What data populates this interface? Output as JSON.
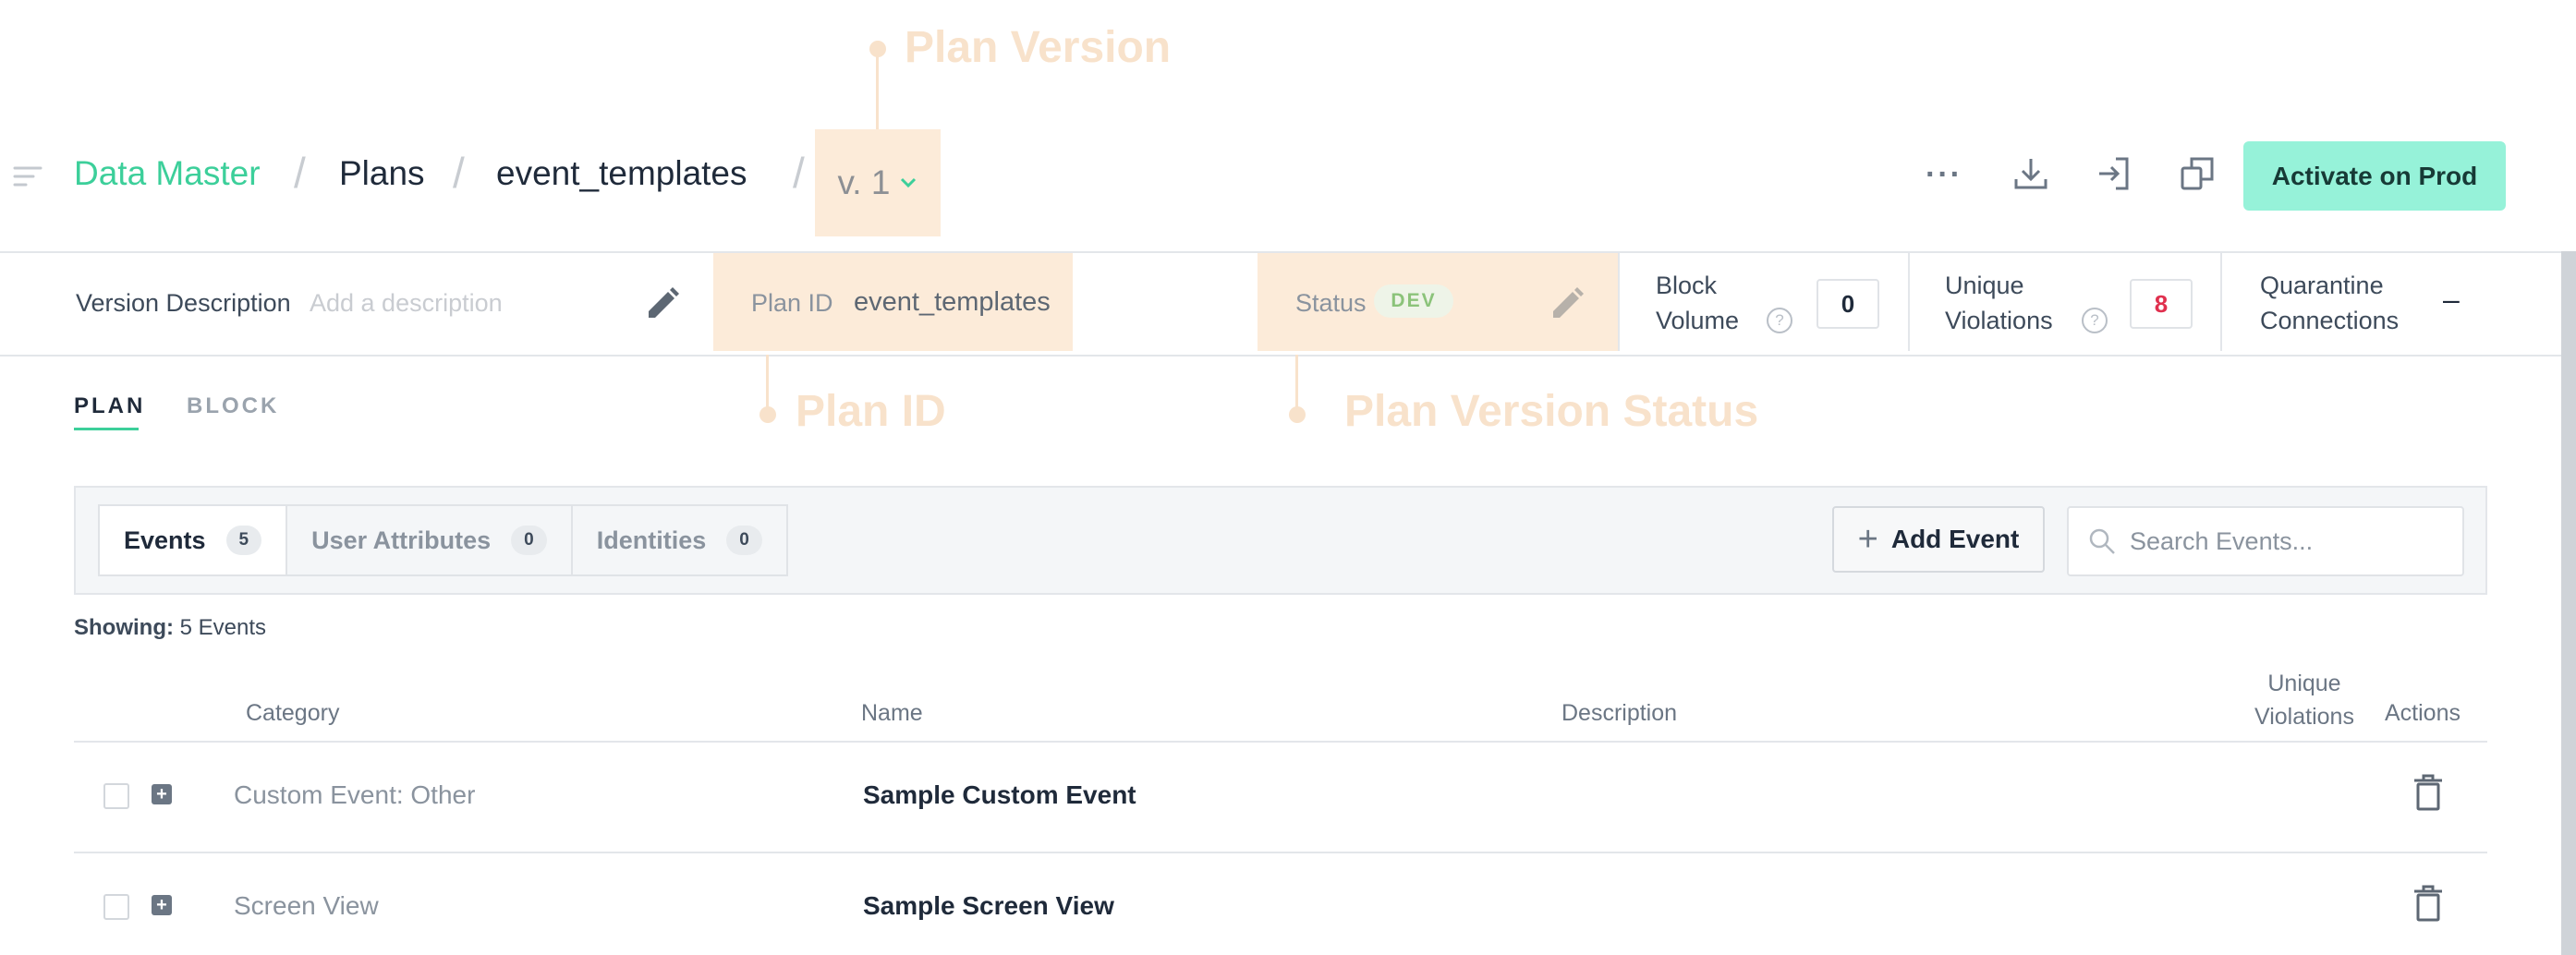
{
  "callouts": {
    "plan_version": "Plan Version",
    "plan_id": "Plan ID",
    "plan_version_status": "Plan Version Status"
  },
  "breadcrumb": {
    "brand": "Data Master",
    "sep": "/",
    "plans": "Plans",
    "plan_name": "event_templates",
    "version": "v. 1"
  },
  "header": {
    "more_label": "···",
    "activate_button": "Activate on Prod"
  },
  "info": {
    "version_description_label": "Version Description",
    "version_description_placeholder": "Add a description",
    "plan_id_label": "Plan ID",
    "plan_id_value": "event_templates",
    "status_label": "Status",
    "status_value": "DEV",
    "block_volume_line1": "Block",
    "block_volume_line2": "Volume",
    "block_volume_value": "0",
    "unique_violations_line1": "Unique",
    "unique_violations_line2": "Violations",
    "unique_violations_value": "8",
    "quarantine_line1": "Quarantine",
    "quarantine_line2": "Connections",
    "quarantine_value": "–",
    "help_glyph": "?"
  },
  "tabs": {
    "plan": "PLAN",
    "block": "BLOCK"
  },
  "subtabs": [
    {
      "label": "Events",
      "count": "5"
    },
    {
      "label": "User Attributes",
      "count": "0"
    },
    {
      "label": "Identities",
      "count": "0"
    }
  ],
  "toolbar": {
    "add_event_label": "Add Event",
    "add_glyph": "+",
    "search_placeholder": "Search Events..."
  },
  "showing": {
    "prefix": "Showing:",
    "text": "5 Events"
  },
  "table": {
    "headers": {
      "category": "Category",
      "name": "Name",
      "description": "Description",
      "unique_line1": "Unique",
      "unique_line2": "Violations",
      "actions": "Actions"
    },
    "expand_glyph": "+",
    "rows": [
      {
        "category": "Custom Event: Other",
        "name": "Sample Custom Event",
        "description": ""
      },
      {
        "category": "Screen View",
        "name": "Sample Screen View",
        "description": ""
      }
    ]
  },
  "colors": {
    "brand": "#3ccf9a",
    "annotation": "#f8e2cb",
    "highlight": "#fcebd9",
    "activate_bg": "#96f2d9",
    "violations_red": "#e0304e"
  },
  "icons": [
    "menu-lines-icon",
    "chevron-down-icon",
    "download-icon",
    "import-icon",
    "copy-icon",
    "pencil-icon",
    "help-icon",
    "search-icon",
    "trash-icon",
    "expand-icon"
  ]
}
